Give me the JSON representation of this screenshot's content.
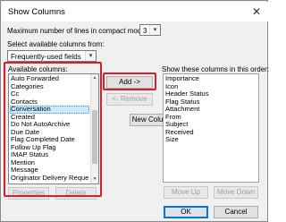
{
  "dialog": {
    "title": "Show Columns",
    "close_glyph": "✕"
  },
  "compact": {
    "label": "Maximum number of lines in compact mode:",
    "value": "3",
    "arrow": "▾"
  },
  "source": {
    "label": "Select available columns from:",
    "value": "Frequently-used fields",
    "arrow": "▾"
  },
  "available": {
    "label": "Available columns:",
    "items": [
      "Auto Forwarded",
      "Categories",
      "Cc",
      "Contacts",
      "Conversation",
      "Created",
      "Do Not AutoArchive",
      "Due Date",
      "Flag Completed Date",
      "Follow Up Flag",
      "IMAP Status",
      "Mention",
      "Message",
      "Originator Delivery Reque:"
    ],
    "selected": "Conversation"
  },
  "shown": {
    "label": "Show these columns in this order:",
    "items": [
      "Importance",
      "Icon",
      "Header Status",
      "Flag Status",
      "Attachment",
      "From",
      "Subject",
      "Received",
      "Size"
    ]
  },
  "buttons": {
    "add": "Add ->",
    "remove": "<- Remove",
    "new_column": "New Column...",
    "properties": "Properties",
    "delete": "Delete",
    "move_up": "Move Up",
    "move_down": "Move Down",
    "ok": "OK",
    "cancel": "Cancel"
  },
  "icons": {
    "close": "close-icon",
    "dropdown": "chevron-down-icon",
    "scroll_up": "scroll-up-icon",
    "scroll_down": "scroll-down-icon"
  },
  "colors": {
    "highlight_box": "#d4202a",
    "selection": "#cce8ff",
    "ok_border": "#0078d7"
  }
}
